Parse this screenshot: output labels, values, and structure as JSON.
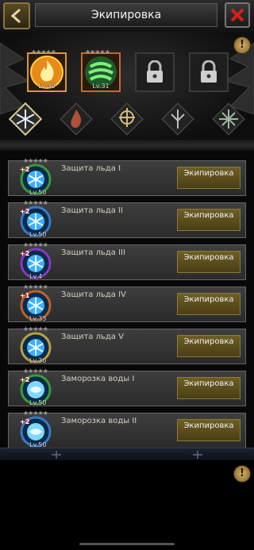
{
  "header": {
    "title": "Экипировка"
  },
  "slots": [
    {
      "stars": "★★★★★",
      "level": "Lv.30",
      "type": "fire"
    },
    {
      "stars": "★★★★★",
      "level": "Lv.31",
      "type": "wind"
    },
    {
      "type": "locked"
    },
    {
      "type": "locked"
    }
  ],
  "elements": [
    "ice-rune",
    "fire-rune",
    "light-rune",
    "nature-rune",
    "star-rune"
  ],
  "skills": [
    {
      "name": "Защита льда I",
      "level": "Lv.50",
      "plus": "+2",
      "stars": "★★★★★",
      "ring": "#3b9a3b",
      "equip": "Экипировка"
    },
    {
      "name": "Защита льда II",
      "level": "Lv.50",
      "plus": "+2",
      "stars": "★★★★★",
      "ring": "#3a7ac8",
      "equip": "Экипировка"
    },
    {
      "name": "Защита льда III",
      "level": "Lv.4",
      "plus": "+2",
      "stars": "★★★★★",
      "ring": "#8a3ac0",
      "equip": "Экипировка"
    },
    {
      "name": "Защита льда IV",
      "level": "Lv.33",
      "plus": "+1",
      "stars": "★★★★★",
      "ring": "#c0602a",
      "equip": "Экипировка"
    },
    {
      "name": "Защита льда V",
      "level": "Lv.30",
      "plus": "",
      "stars": "★★★★★",
      "ring": "#b8a040",
      "equip": "Экипировка"
    },
    {
      "name": "Заморозка воды I",
      "level": "Lv.50",
      "plus": "+2",
      "stars": "★★★★★",
      "ring": "#3b9a3b",
      "equip": "Экипировка"
    },
    {
      "name": "Заморозка воды II",
      "level": "Lv.50",
      "plus": "+2",
      "stars": "★★★★★",
      "ring": "#3a7ac8",
      "equip": "Экипировка"
    }
  ],
  "colors": {
    "gold": "#d49a3a",
    "button": "#5e5020",
    "panel": "#363636"
  }
}
